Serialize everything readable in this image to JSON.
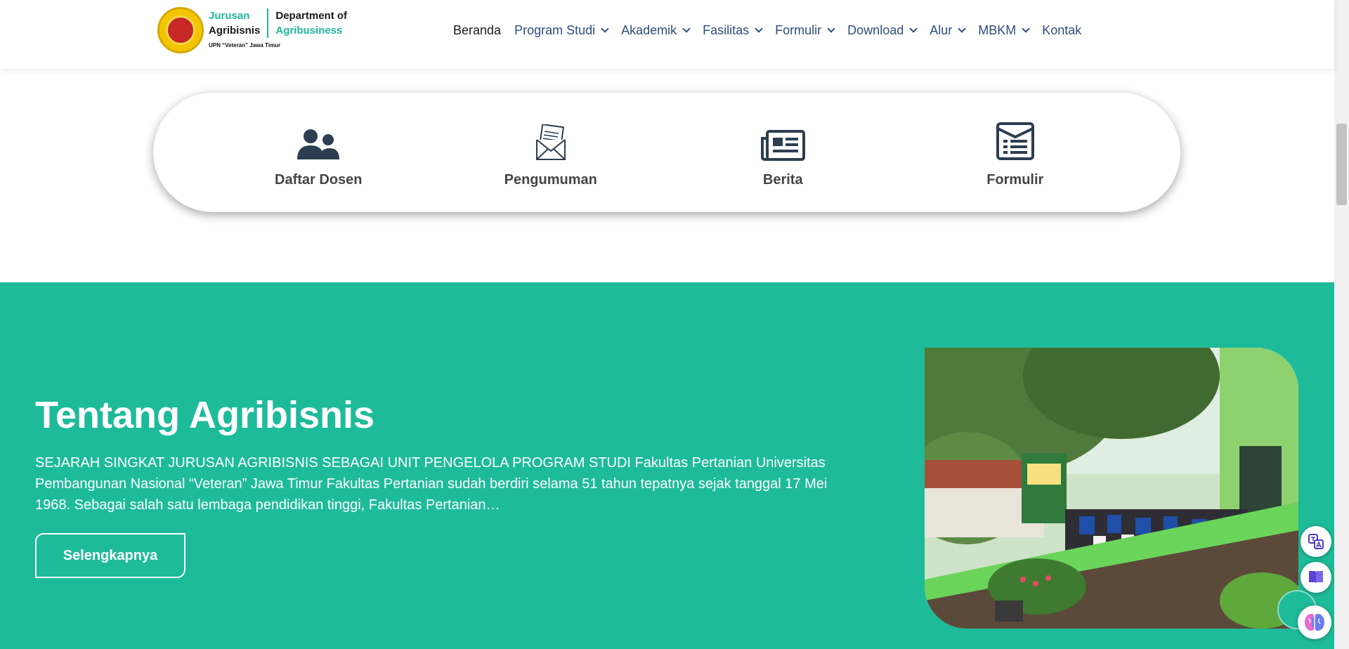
{
  "header": {
    "logo": {
      "line1": "Jurusan",
      "line2": "Agribisnis",
      "line3": "Department of",
      "line4": "Agribusiness",
      "subtitle": "UPN “Veteran” Jawa Timur"
    },
    "nav": [
      {
        "label": "Beranda",
        "dropdown": false,
        "active": true
      },
      {
        "label": "Program Studi",
        "dropdown": true
      },
      {
        "label": "Akademik",
        "dropdown": true
      },
      {
        "label": "Fasilitas",
        "dropdown": true
      },
      {
        "label": "Formulir",
        "dropdown": true
      },
      {
        "label": "Download",
        "dropdown": true
      },
      {
        "label": "Alur",
        "dropdown": true
      },
      {
        "label": "MBKM",
        "dropdown": true
      },
      {
        "label": "Kontak",
        "dropdown": false
      }
    ]
  },
  "quick_links": [
    {
      "label": "Daftar Dosen",
      "icon": "users-icon"
    },
    {
      "label": "Pengumuman",
      "icon": "envelope-letter-icon"
    },
    {
      "label": "Berita",
      "icon": "newspaper-icon"
    },
    {
      "label": "Formulir",
      "icon": "form-icon"
    }
  ],
  "about": {
    "title": "Tentang Agribisnis",
    "text": "SEJARAH SINGKAT  JURUSAN AGRIBISNIS SEBAGAI UNIT PENGELOLA PROGRAM STUDI Fakultas Pertanian Universitas Pembangunan Nasional “Veteran” Jawa Timur Fakultas Pertanian sudah berdiri selama 51 tahun tepatnya sejak tanggal 17 Mei 1968. Sebagai salah satu lembaga pendidikan tinggi, Fakultas Pertanian…",
    "button": "Selengkapnya"
  },
  "colors": {
    "accent_green": "#1ebb9a",
    "nav_text": "#2f4d7c",
    "icon_dark": "#2c3e50"
  }
}
